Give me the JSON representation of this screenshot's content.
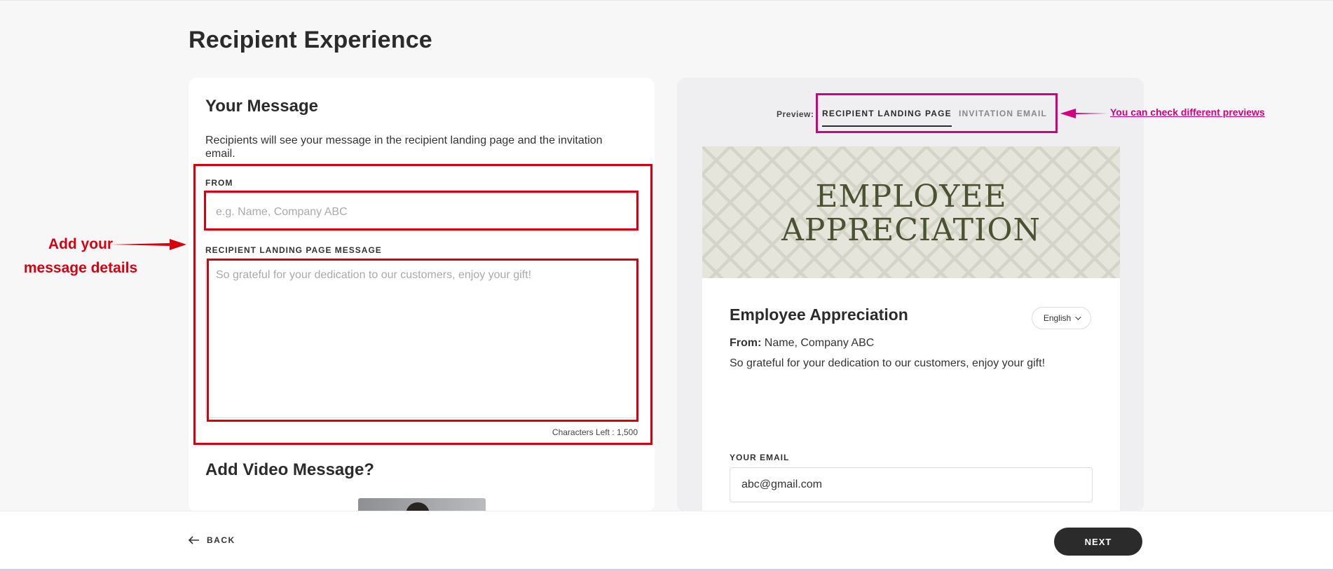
{
  "page": {
    "title": "Recipient Experience"
  },
  "your_message": {
    "title": "Your Message",
    "description": "Recipients will see your message in the recipient landing page and the invitation email.",
    "from_label": "FROM",
    "from_placeholder": "e.g. Name, Company ABC",
    "from_value": "",
    "landing_label": "RECIPIENT LANDING PAGE MESSAGE",
    "landing_placeholder": "So grateful for your dedication to our customers, enjoy your gift!",
    "landing_value": "",
    "chars_left": "Characters Left : 1,500"
  },
  "video": {
    "title": "Add Video Message?"
  },
  "preview": {
    "label": "Preview:",
    "tabs": [
      {
        "label": "RECIPIENT LANDING PAGE",
        "active": true
      },
      {
        "label": "INVITATION EMAIL",
        "active": false
      }
    ],
    "banner_line1": "EMPLOYEE",
    "banner_line2": "APPRECIATION",
    "landing_title": "Employee Appreciation",
    "language": "English",
    "from_prefix": "From:",
    "from_value": "Name, Company ABC",
    "message": "So grateful for your dedication to our customers, enjoy your gift!",
    "email_label": "YOUR EMAIL",
    "email_value": "abc@gmail.com"
  },
  "annotations": {
    "left_line1": "Add your",
    "left_line2": "message details",
    "right": "You can check different previews",
    "left_color": "#d6000f",
    "right_color": "#d0007f"
  },
  "footer": {
    "back_label": "BACK",
    "next_label": "NEXT"
  }
}
